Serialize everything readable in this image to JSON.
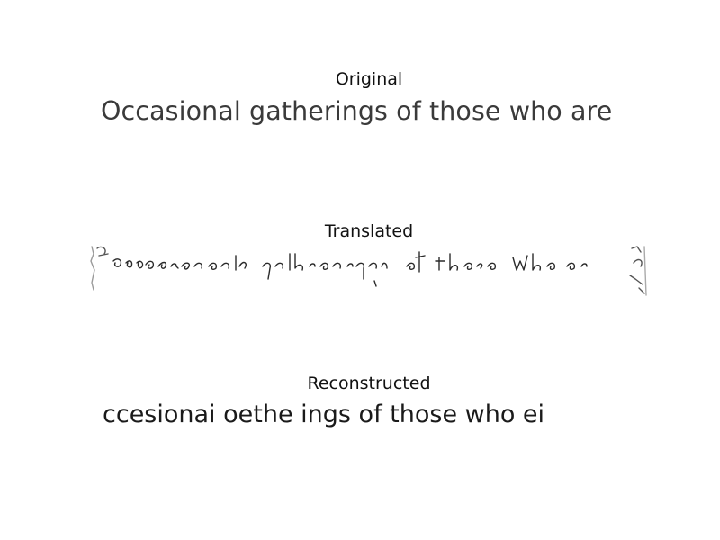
{
  "panels": [
    {
      "title": "Original",
      "text": "Occasional gatherings of those who are"
    },
    {
      "title": "Translated",
      "text": ""
    },
    {
      "title": "Reconstructed",
      "text": "ccesionai oethe ings of those who ei"
    }
  ]
}
